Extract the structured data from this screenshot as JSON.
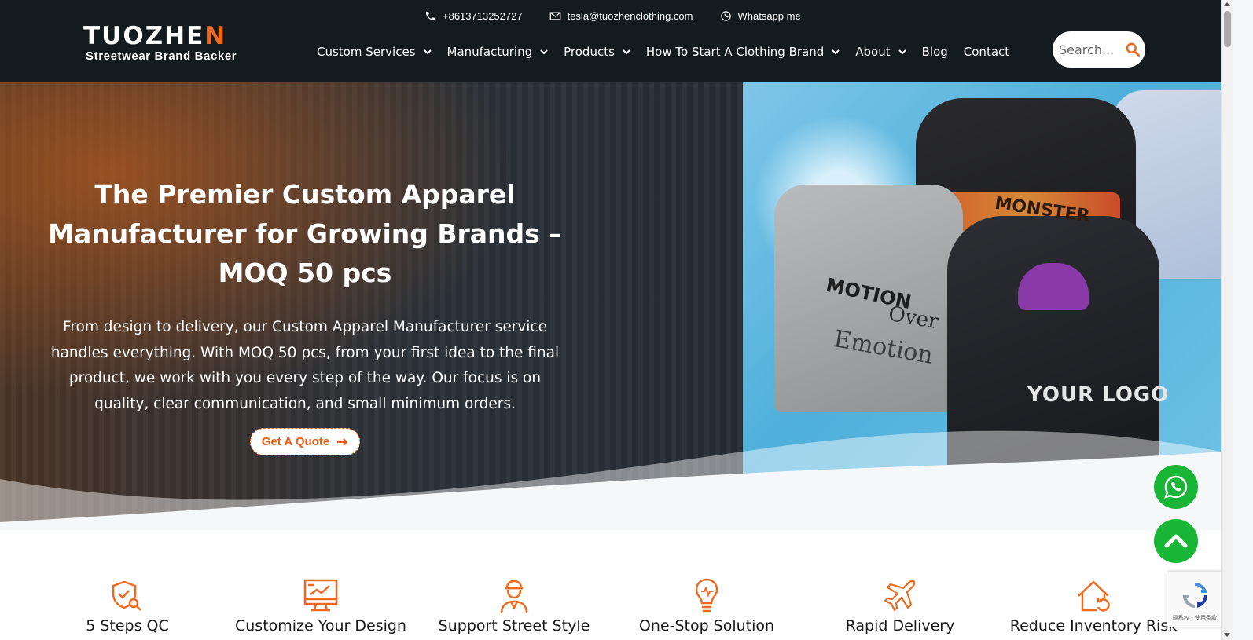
{
  "brand": {
    "logo_main_a": "TUOZHE",
    "logo_main_b": "N",
    "tagline": "Streetwear Brand Backer",
    "accent_color": "#ef6a1e"
  },
  "topbar": {
    "phone": "+8613713252727",
    "email": "tesla@tuozhenclothing.com",
    "whatsapp": "Whatsapp me"
  },
  "nav": {
    "items": [
      {
        "label": "Custom Services",
        "dropdown": true
      },
      {
        "label": "Manufacturing",
        "dropdown": true
      },
      {
        "label": "Products",
        "dropdown": true
      },
      {
        "label": "How To Start A Clothing Brand",
        "dropdown": true
      },
      {
        "label": "About",
        "dropdown": true
      },
      {
        "label": "Blog",
        "dropdown": false
      },
      {
        "label": "Contact",
        "dropdown": false
      }
    ]
  },
  "search": {
    "placeholder": "Search..."
  },
  "hero": {
    "title": "The Premier Custom Apparel Manufacturer for Growing Brands – MOQ 50 pcs",
    "description": "From design to delivery, our Custom Apparel Manufacturer service handles everything. With MOQ 50 pcs, from your first idea to the final product, we work with you every step of the way. Our focus is on quality, clear communication, and small minimum orders.",
    "cta_label": "Get A Quote",
    "image_text": {
      "motion": "MOTION",
      "over": "Over",
      "emotion": "Emotion",
      "your_logo": "YOUR LOGO",
      "monster": "MONSTER"
    }
  },
  "features": [
    {
      "label": "5 Steps QC",
      "icon": "shield-check-icon"
    },
    {
      "label": "Customize Your Design",
      "icon": "monitor-design-icon"
    },
    {
      "label": "Support Street Style",
      "icon": "person-cap-icon"
    },
    {
      "label": "One-Stop Solution",
      "icon": "lightbulb-icon"
    },
    {
      "label": "Rapid Delivery",
      "icon": "airplane-icon"
    },
    {
      "label": "Reduce Inventory Risk",
      "icon": "house-refresh-icon"
    }
  ],
  "recaptcha": {
    "text": "隐私权 - 使用条款"
  },
  "colors": {
    "header_bg": "#141b1f",
    "float_green": "#18b536"
  }
}
